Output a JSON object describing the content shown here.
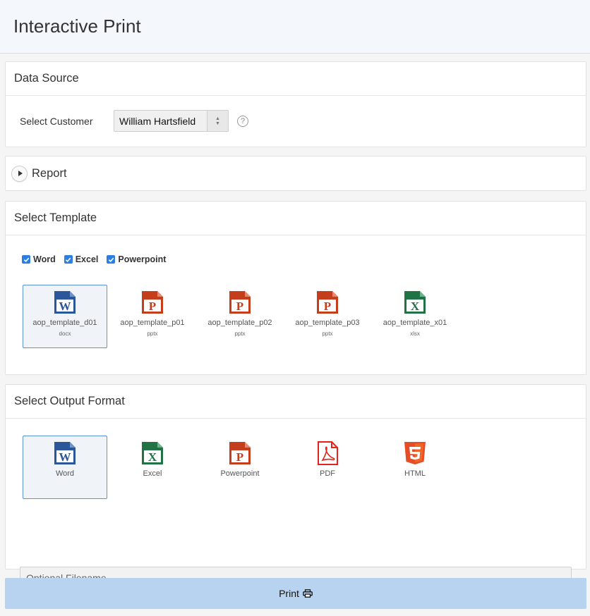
{
  "page": {
    "title": "Interactive Print"
  },
  "data_source": {
    "title": "Data Source",
    "customer_label": "Select Customer",
    "customer_value": "William Hartsfield",
    "help": "?"
  },
  "report": {
    "title": "Report"
  },
  "select_template": {
    "title": "Select Template",
    "filters": [
      {
        "label": "Word",
        "checked": true
      },
      {
        "label": "Excel",
        "checked": true
      },
      {
        "label": "Powerpoint",
        "checked": true
      }
    ],
    "templates": [
      {
        "name": "aop_template_d01",
        "ext": "docx",
        "icon": "word-icon",
        "selected": true
      },
      {
        "name": "aop_template_p01",
        "ext": "pptx",
        "icon": "powerpoint-icon",
        "selected": false
      },
      {
        "name": "aop_template_p02",
        "ext": "pptx",
        "icon": "powerpoint-icon",
        "selected": false
      },
      {
        "name": "aop_template_p03",
        "ext": "pptx",
        "icon": "powerpoint-icon",
        "selected": false
      },
      {
        "name": "aop_template_x01",
        "ext": "xlsx",
        "icon": "excel-icon",
        "selected": false
      }
    ]
  },
  "output_format": {
    "title": "Select Output Format",
    "formats": [
      {
        "label": "Word",
        "icon": "word-icon",
        "selected": true
      },
      {
        "label": "Excel",
        "icon": "excel-icon",
        "selected": false
      },
      {
        "label": "Powerpoint",
        "icon": "powerpoint-icon",
        "selected": false
      },
      {
        "label": "PDF",
        "icon": "pdf-icon",
        "selected": false
      },
      {
        "label": "HTML",
        "icon": "html5-icon",
        "selected": false
      }
    ],
    "filename_placeholder": "Optional Filename"
  },
  "print": {
    "label": "Print",
    "icon": "printer-icon"
  },
  "colors": {
    "word": "#2b579a",
    "excel": "#217346",
    "powerpoint": "#c43e1c",
    "pdf": "#e2231a",
    "html": "#e44d26",
    "primary_button": "#b8d3f0",
    "selection_border": "#5b94d6"
  }
}
